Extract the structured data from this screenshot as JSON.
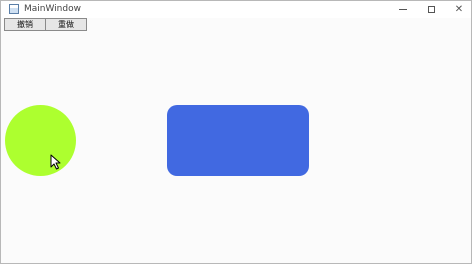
{
  "window": {
    "title": "MainWindow",
    "icon": "app-window-icon"
  },
  "controls": {
    "minimize": "minimize-icon",
    "maximize": "maximize-icon",
    "close_glyph": "✕"
  },
  "toolbar": {
    "undo_label": "撤销",
    "redo_label": "重做"
  },
  "canvas": {
    "shapes": [
      {
        "kind": "circle",
        "color": "#adff2f"
      },
      {
        "kind": "rounded-rectangle",
        "color": "#4169e1"
      }
    ],
    "cursor": "arrow-cursor-icon"
  }
}
